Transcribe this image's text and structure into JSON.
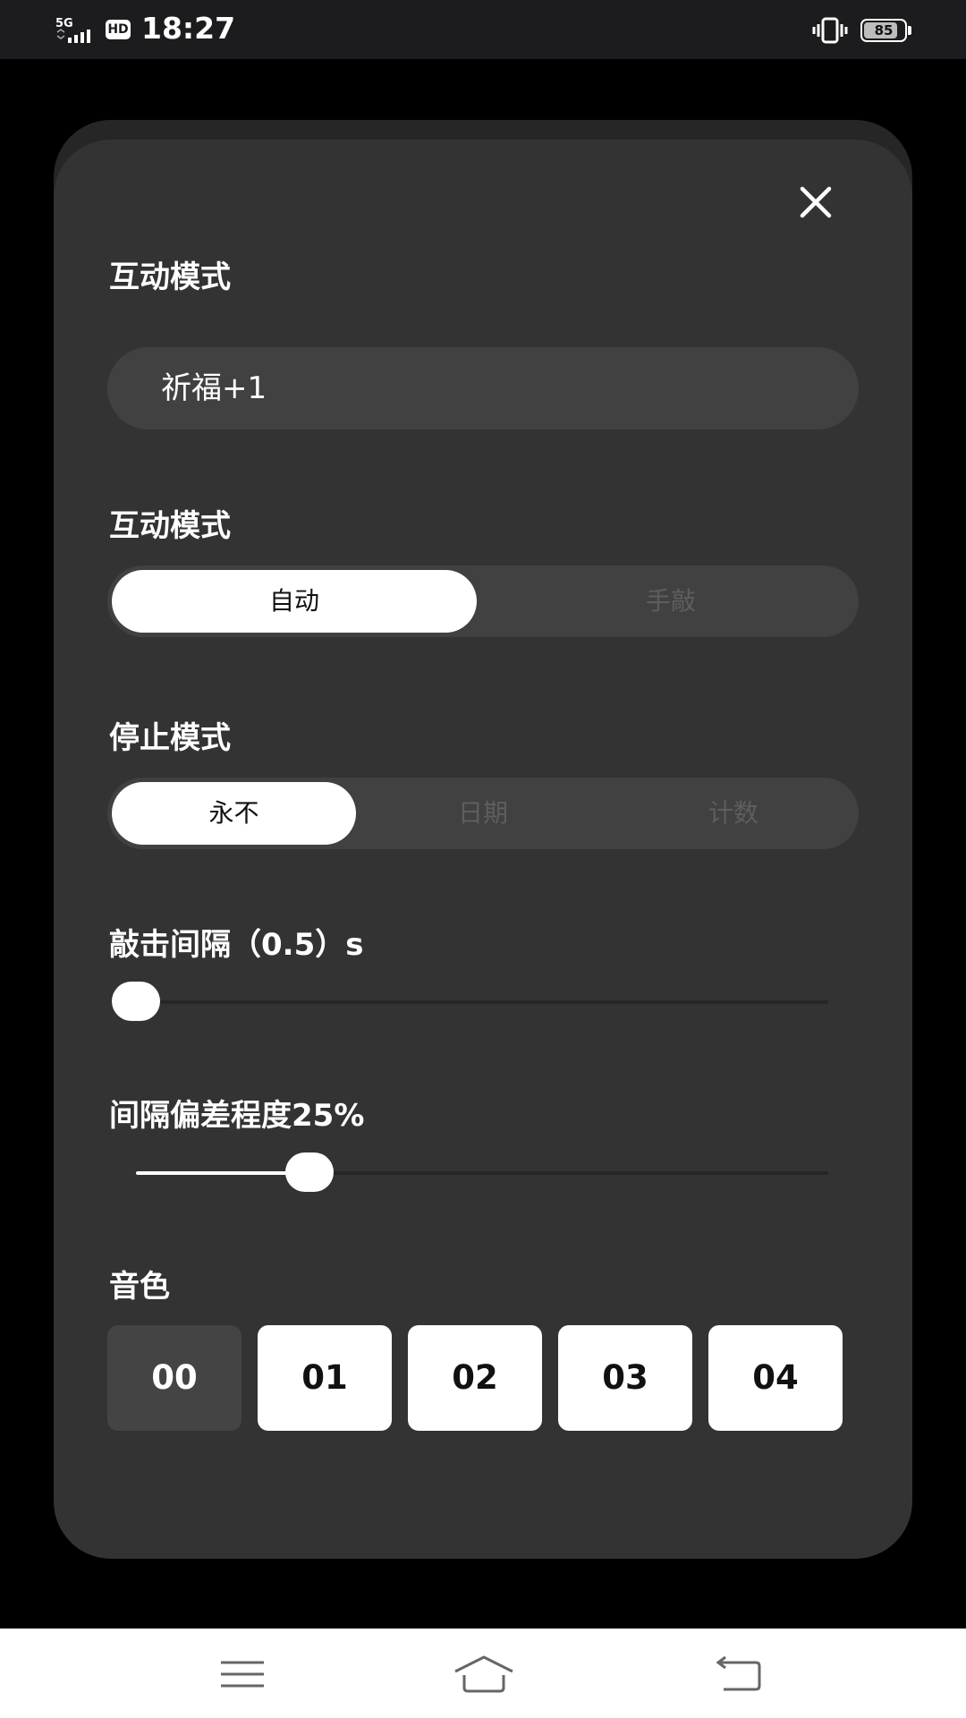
{
  "status_bar": {
    "network": "5G",
    "hd_badge": "HD",
    "time": "18:27",
    "battery_level": "85",
    "battery_fraction": 0.85
  },
  "dialog": {
    "interaction_mode_title": "互动模式",
    "blessing_input_value": "祈福+1",
    "interaction_mode_title_2": "互动模式",
    "interaction_modes": [
      {
        "label": "自动",
        "selected": true
      },
      {
        "label": "手敲",
        "selected": false
      }
    ],
    "stop_mode_title": "停止模式",
    "stop_modes": [
      {
        "label": "永不",
        "selected": true
      },
      {
        "label": "日期",
        "selected": false
      },
      {
        "label": "计数",
        "selected": false
      }
    ],
    "knock_interval_label": "敲击间隔（0.5）s",
    "knock_interval_fraction": 0.0,
    "deviation_label": "间隔偏差程度25%",
    "deviation_fraction": 0.25,
    "tone_title": "音色",
    "tones": [
      {
        "label": "00",
        "selected": true
      },
      {
        "label": "01",
        "selected": false
      },
      {
        "label": "02",
        "selected": false
      },
      {
        "label": "03",
        "selected": false
      },
      {
        "label": "04",
        "selected": false
      }
    ]
  },
  "icons": {
    "close": "close-icon",
    "nav_menu": "menu-icon",
    "nav_home": "home-icon",
    "nav_back": "back-icon"
  },
  "colors": {
    "panel": "#333333",
    "control_bg": "#414141",
    "selected": "#ffffff",
    "unselected_text": "#5e5e5e"
  }
}
